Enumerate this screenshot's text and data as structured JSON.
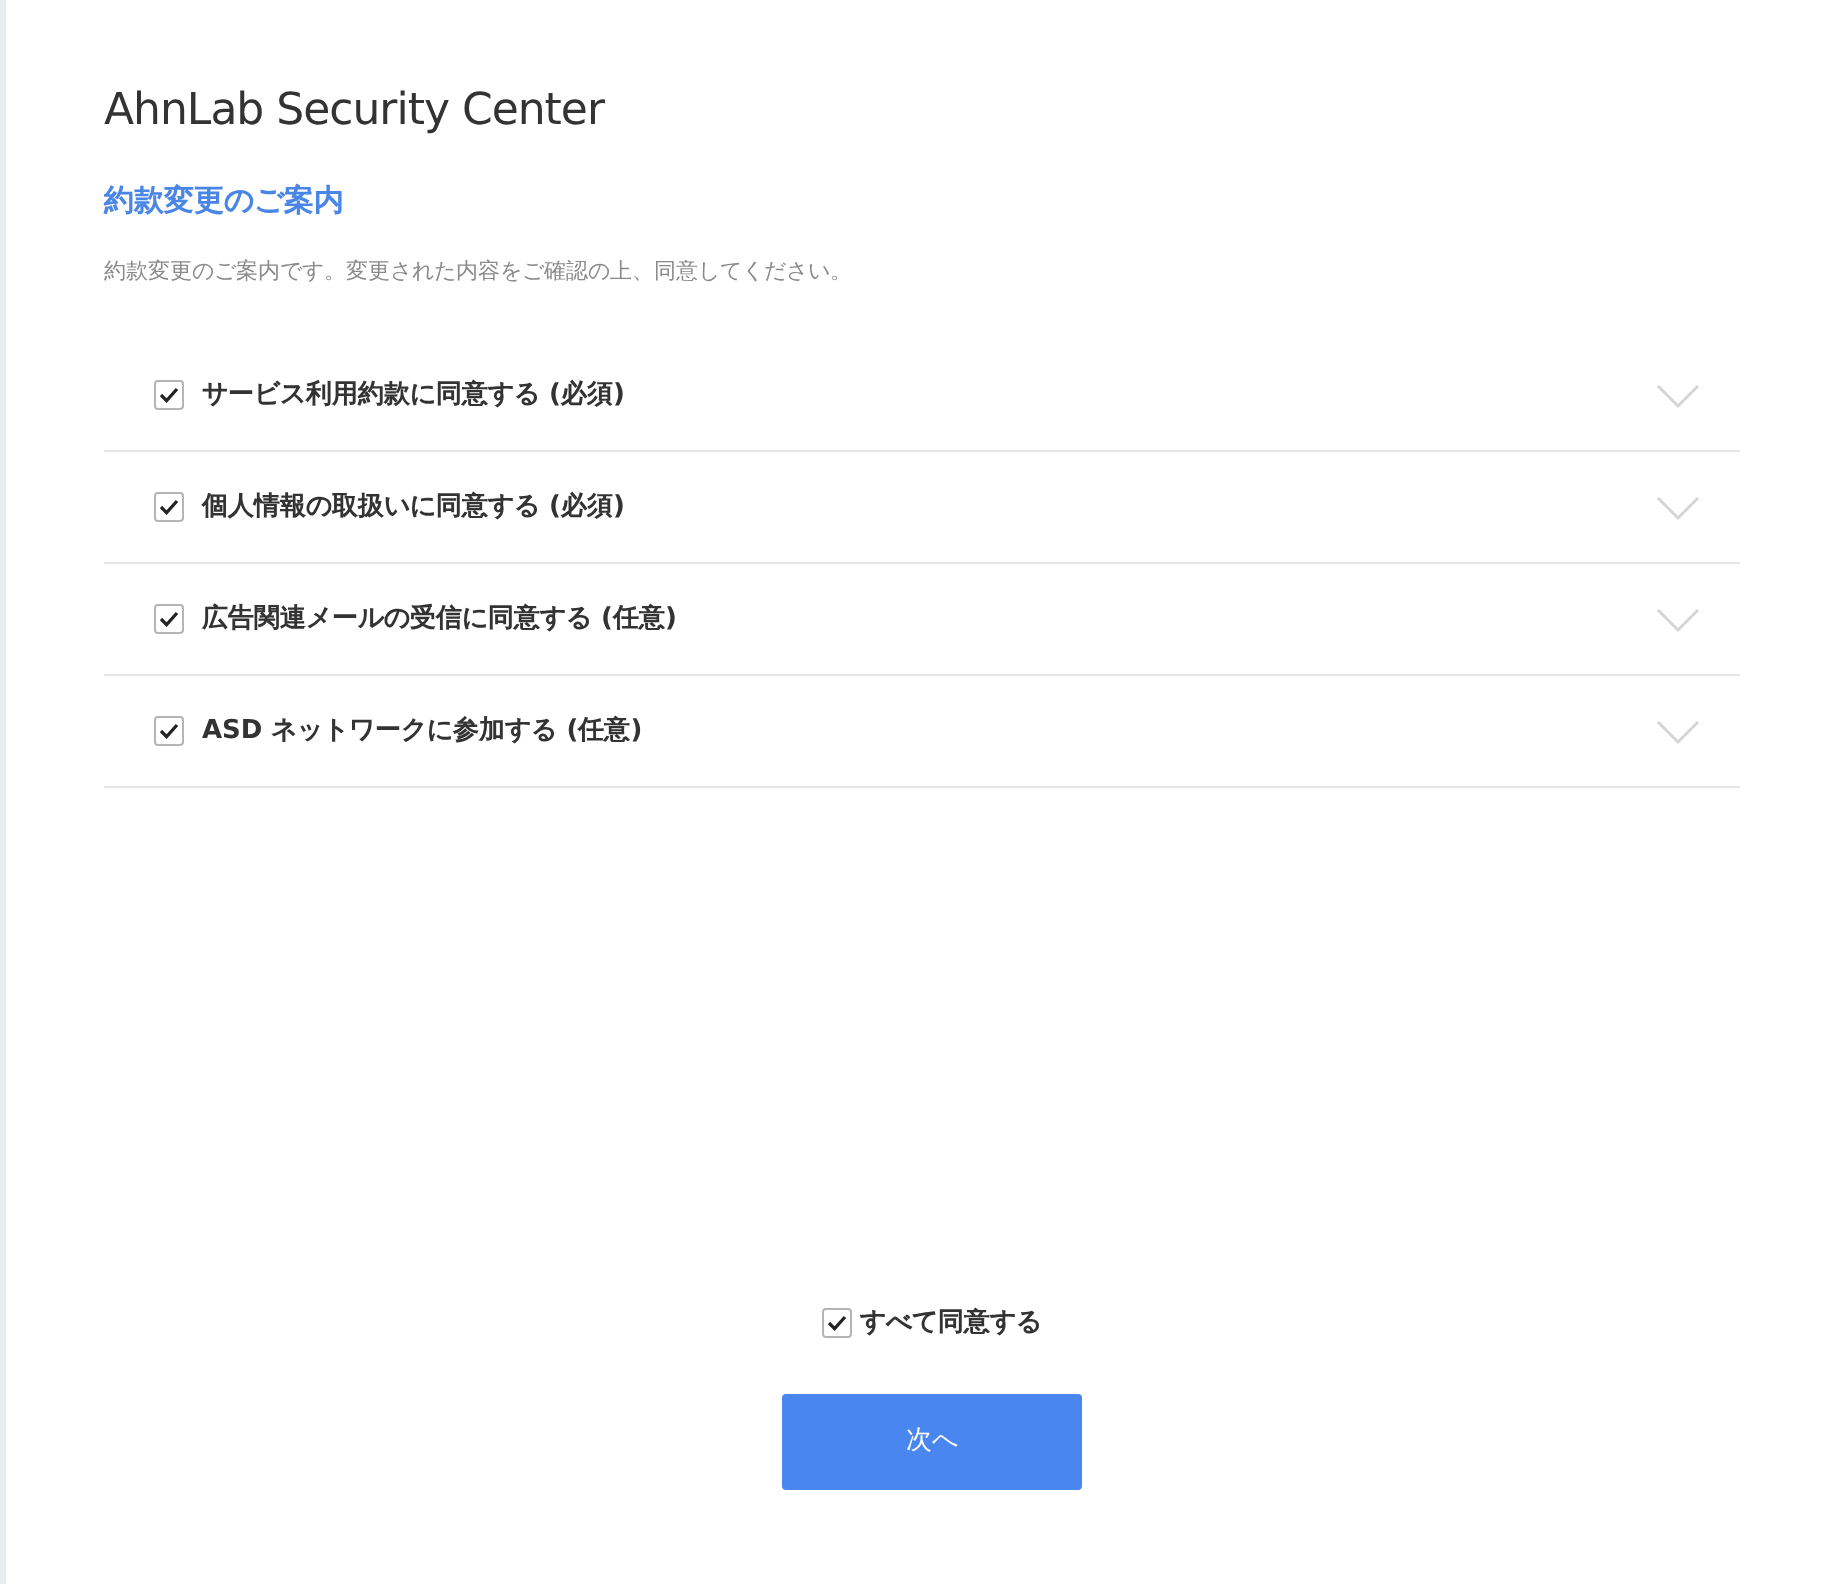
{
  "app_title": "AhnLab Security Center",
  "heading": "約款変更のご案内",
  "description": "約款変更のご案内です。変更された内容をご確認の上、同意してください。",
  "terms": [
    {
      "label": "サービス利用約款に同意する (必須)",
      "checked": true,
      "expanded": false
    },
    {
      "label": "個人情報の取扱いに同意する (必須)",
      "checked": true,
      "expanded": false
    },
    {
      "label": "広告関連メールの受信に同意する (任意)",
      "checked": true,
      "expanded": false
    },
    {
      "label": "ASD ネットワークに参加する (任意)",
      "checked": true,
      "expanded": false
    }
  ],
  "agree_all": {
    "label": "すべて同意する",
    "checked": true
  },
  "next_button": "次へ"
}
